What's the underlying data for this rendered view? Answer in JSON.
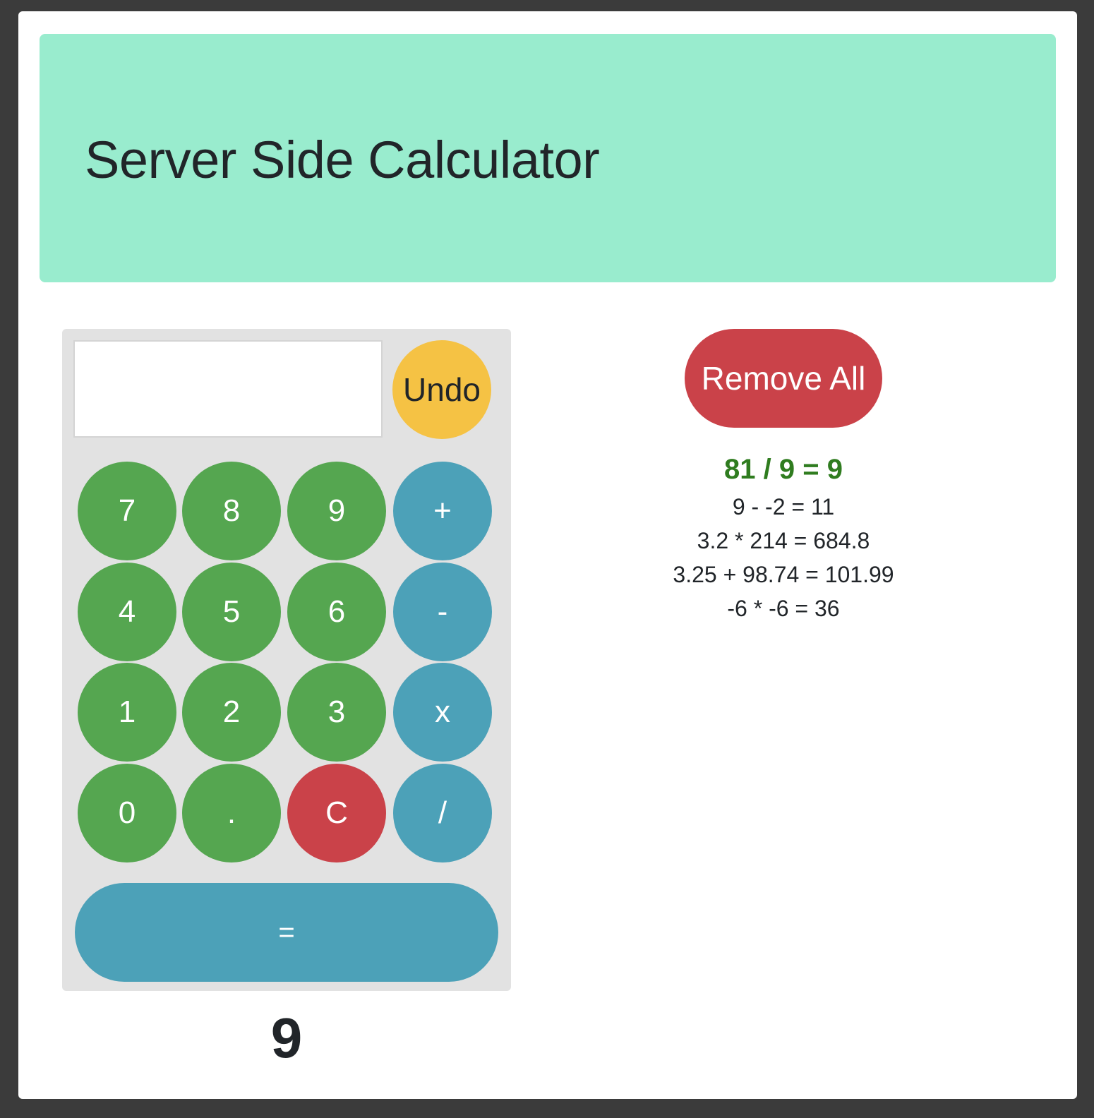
{
  "header": {
    "title": "Server Side Calculator"
  },
  "calculator": {
    "display_value": "",
    "undo_label": "Undo",
    "keys": [
      {
        "label": "7",
        "name": "key-7",
        "kind": "digit"
      },
      {
        "label": "8",
        "name": "key-8",
        "kind": "digit"
      },
      {
        "label": "9",
        "name": "key-9",
        "kind": "digit"
      },
      {
        "label": "+",
        "name": "key-plus",
        "kind": "operator"
      },
      {
        "label": "4",
        "name": "key-4",
        "kind": "digit"
      },
      {
        "label": "5",
        "name": "key-5",
        "kind": "digit"
      },
      {
        "label": "6",
        "name": "key-6",
        "kind": "digit"
      },
      {
        "label": "-",
        "name": "key-minus",
        "kind": "operator"
      },
      {
        "label": "1",
        "name": "key-1",
        "kind": "digit"
      },
      {
        "label": "2",
        "name": "key-2",
        "kind": "digit"
      },
      {
        "label": "3",
        "name": "key-3",
        "kind": "digit"
      },
      {
        "label": "x",
        "name": "key-multiply",
        "kind": "operator"
      },
      {
        "label": "0",
        "name": "key-0",
        "kind": "digit"
      },
      {
        "label": ".",
        "name": "key-decimal",
        "kind": "digit"
      },
      {
        "label": "C",
        "name": "key-clear",
        "kind": "clear"
      },
      {
        "label": "/",
        "name": "key-divide",
        "kind": "operator"
      }
    ],
    "equals_label": "=",
    "result": "9"
  },
  "history": {
    "remove_all_label": "Remove All",
    "entries": [
      "81 / 9 = 9",
      "9 - -2 = 11",
      "3.2 * 214 = 684.8",
      "3.25 + 98.74 = 101.99",
      "-6 * -6 = 36"
    ]
  },
  "colors": {
    "header_bg": "#99ecce",
    "digit": "#55a650",
    "operator": "#4ca1b8",
    "clear": "#ca4249",
    "undo": "#f5c244",
    "latest_history": "#2f7c1f"
  }
}
